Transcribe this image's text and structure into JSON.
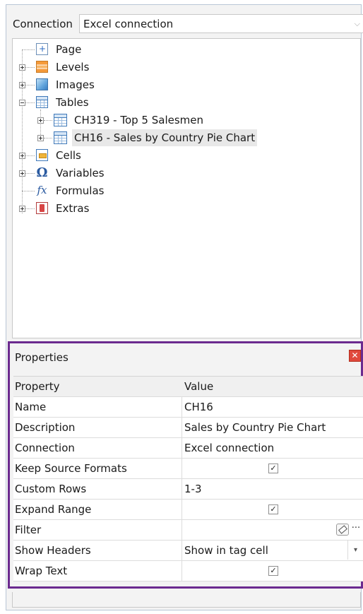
{
  "connection": {
    "label": "Connection",
    "selected_value": "Excel connection",
    "arrow": "⌵"
  },
  "tree": {
    "page": "Page",
    "levels": "Levels",
    "images": "Images",
    "tables": "Tables",
    "table_1": "CH319 - Top 5 Salesmen",
    "table_2": "CH16 - Sales by Country Pie Chart",
    "cells": "Cells",
    "variables": "Variables",
    "formulas": "Formulas",
    "extras": "Extras",
    "icons": {
      "page": "page-icon",
      "levels": "levels-icon",
      "images": "images-icon",
      "tables": "table-icon",
      "cells": "cells-icon",
      "variables": "omega-icon",
      "formulas": "fx-icon",
      "extras": "extras-icon"
    }
  },
  "properties": {
    "title": "Properties",
    "close": "✕",
    "header": {
      "property": "Property",
      "value": "Value"
    },
    "rows": [
      {
        "property": "Name",
        "value": "CH16"
      },
      {
        "property": "Description",
        "value": "Sales by Country Pie Chart"
      },
      {
        "property": "Connection",
        "value": "Excel connection"
      },
      {
        "property": "Keep Source Formats",
        "checked": true
      },
      {
        "property": "Custom Rows",
        "value": "1-3"
      },
      {
        "property": "Expand Range",
        "checked": true
      },
      {
        "property": "Filter",
        "value": ""
      },
      {
        "property": "Show Headers",
        "value": "Show in tag cell"
      },
      {
        "property": "Wrap Text",
        "checked": true
      }
    ],
    "check_glyph": "✓",
    "ellipsis": "···",
    "dropdown_arrow": "▾"
  }
}
